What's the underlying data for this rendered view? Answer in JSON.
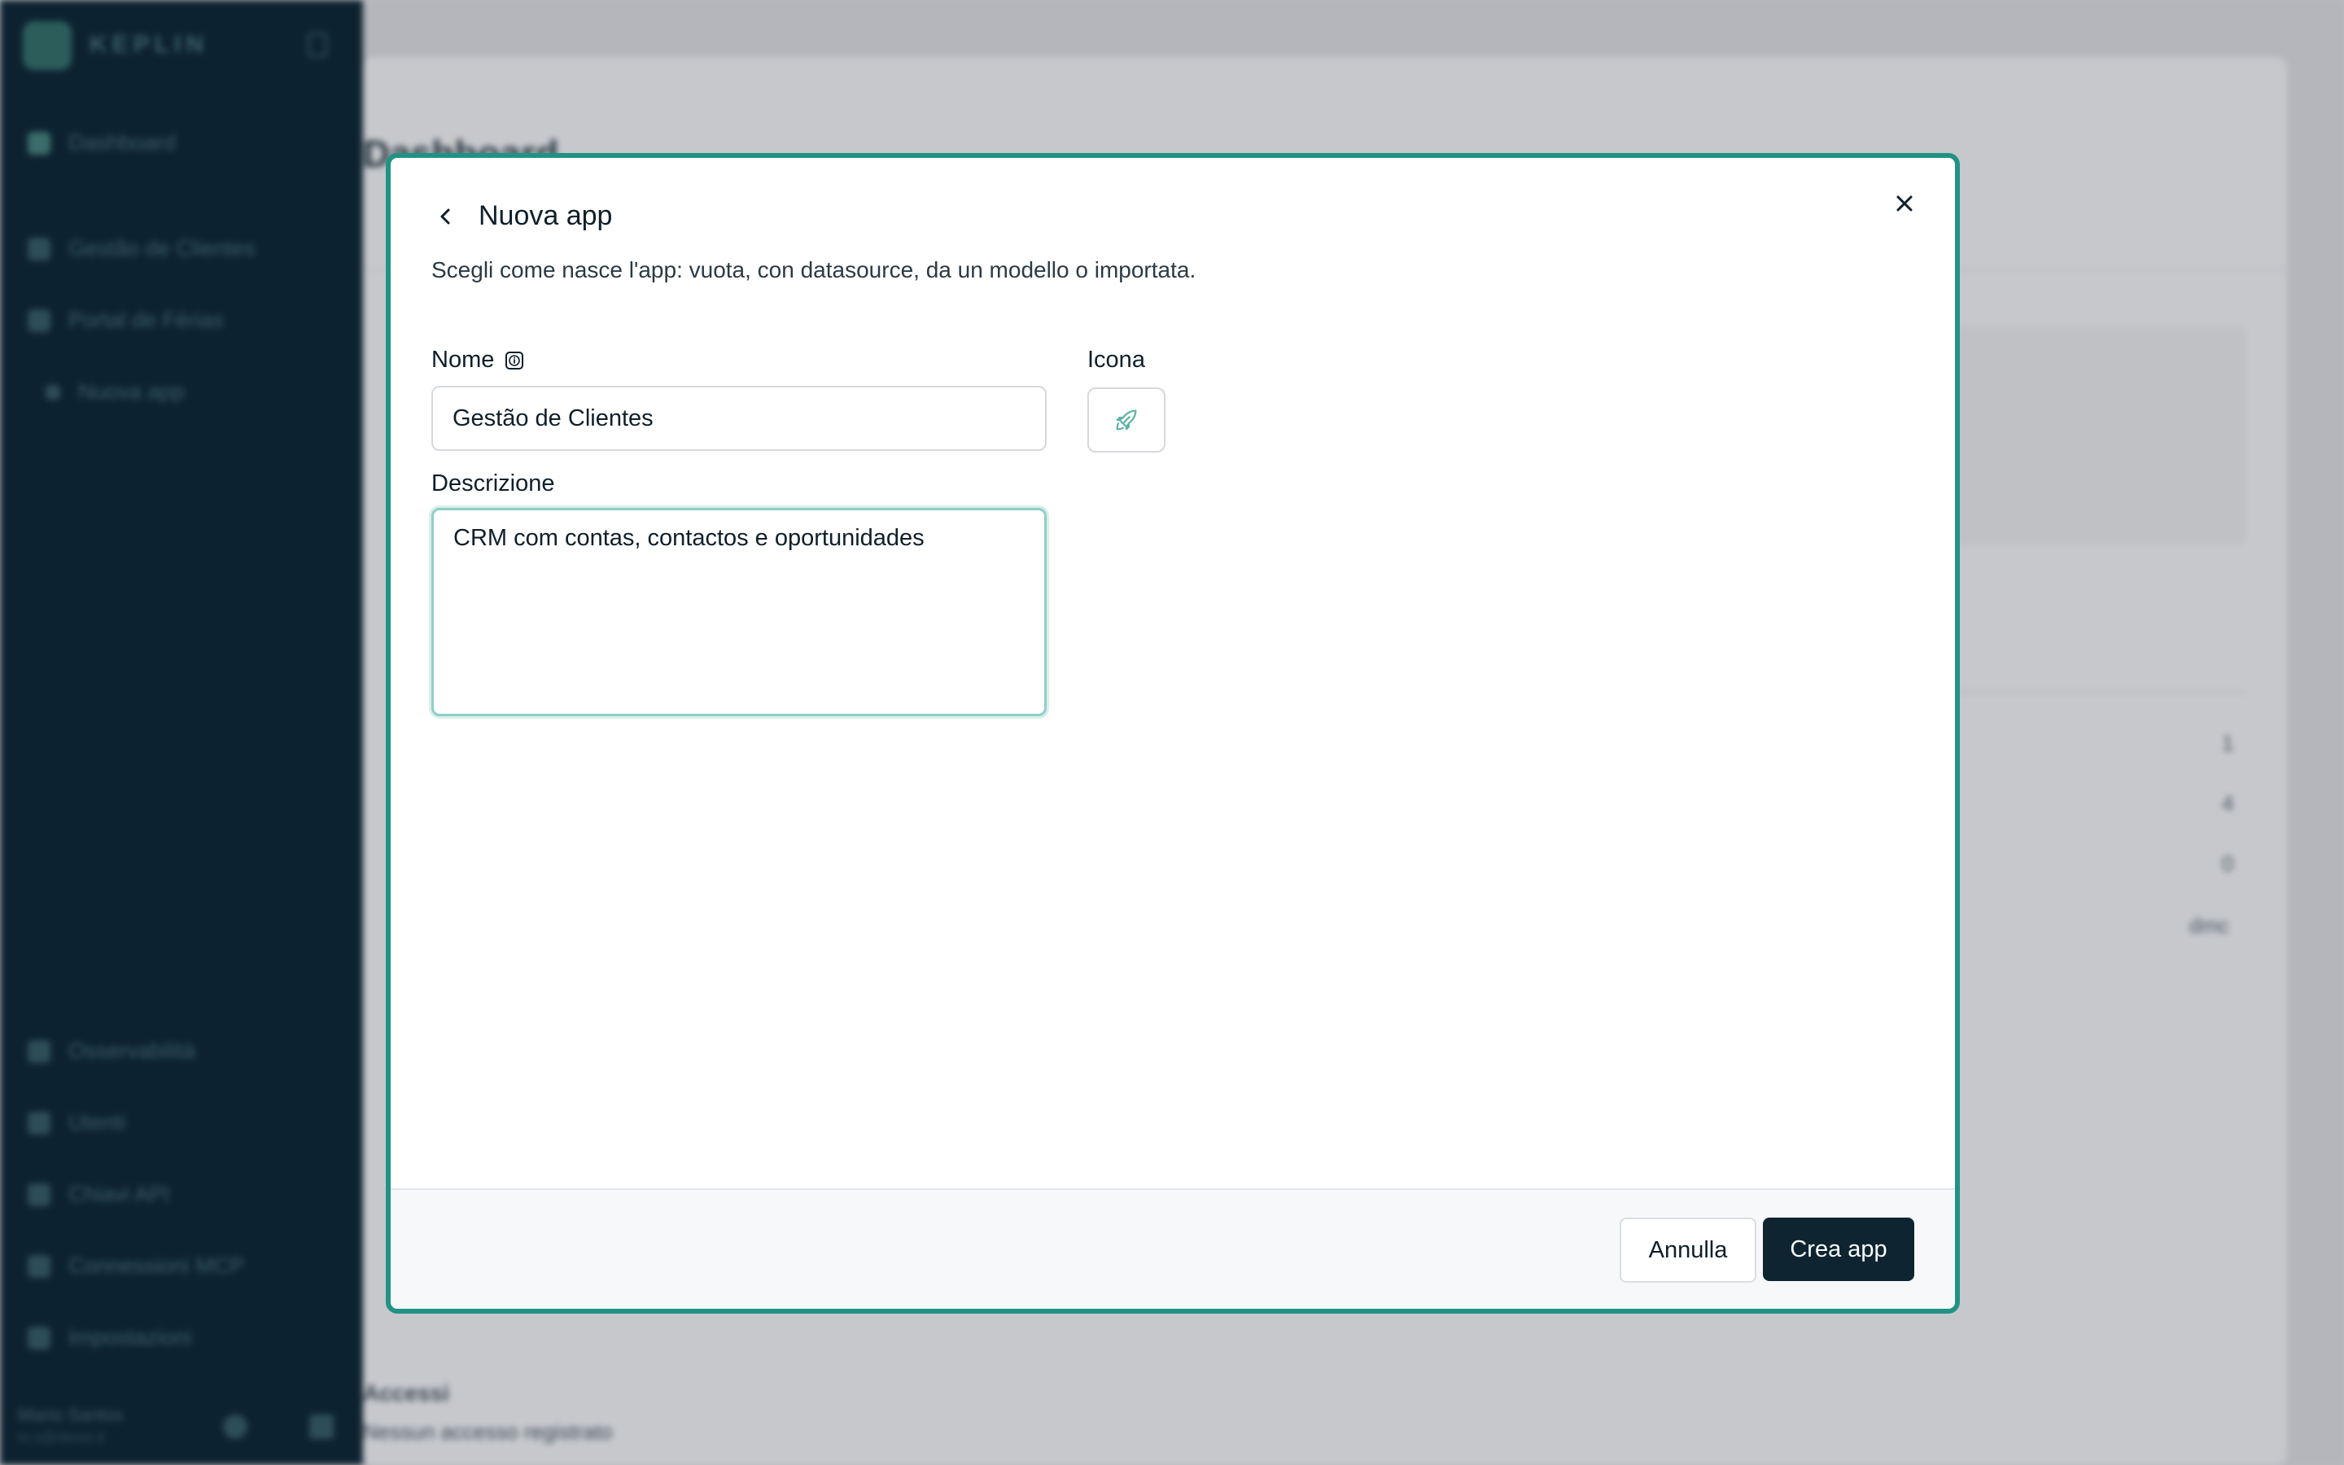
{
  "sidebar": {
    "brand": "KEPLIN",
    "items": [
      {
        "label": "Dashboard",
        "icon": "dashboard-icon"
      },
      {
        "label": "Gestão de Clientes",
        "icon": "app-icon"
      },
      {
        "label": "Portal de Férias",
        "icon": "rocket-icon"
      },
      {
        "label": "Nuova app",
        "icon": "plus-icon"
      },
      {
        "label": "Osservabilità",
        "icon": "chart-icon"
      },
      {
        "label": "Utenti",
        "icon": "users-icon"
      },
      {
        "label": "Chiavi API",
        "icon": "key-icon"
      },
      {
        "label": "Connessioni MCP",
        "icon": "plug-icon"
      },
      {
        "label": "Impostazioni",
        "icon": "gear-icon"
      }
    ],
    "user": {
      "name": "Mario Santos",
      "email": "m.s@demo.it"
    }
  },
  "background": {
    "page_title": "Dashboard",
    "values": [
      "1",
      "4",
      "0",
      "dmc"
    ],
    "footer_title": "Accessi",
    "footer_sub": "Nessun accesso registrato"
  },
  "modal": {
    "title": "Nuova app",
    "subtitle": "Scegli come nasce l'app: vuota, con datasource, da un modello o importata.",
    "name_label": "Nome",
    "name_value": "Gestão de Clientes",
    "icon_label": "Icona",
    "icon_name": "rocket-icon",
    "description_label": "Descrizione",
    "description_value": "CRM com contas, contactos e oportunidades",
    "cancel_label": "Annulla",
    "create_label": "Crea app"
  },
  "colors": {
    "accent": "#219384",
    "sidebar_bg": "#0d2230",
    "primary_button": "#0e2431"
  }
}
